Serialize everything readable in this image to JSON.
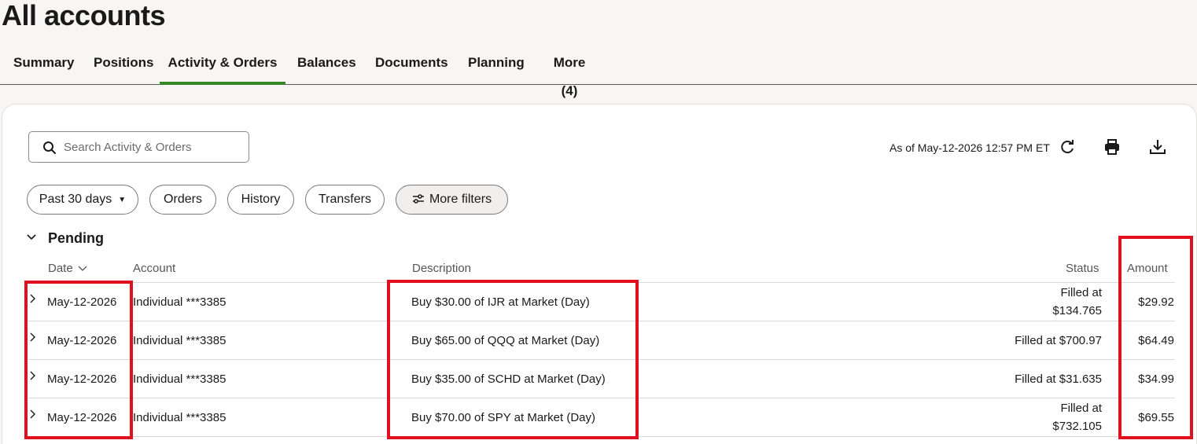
{
  "page": {
    "title": "All accounts"
  },
  "tabs": [
    {
      "label": "Summary"
    },
    {
      "label": "Positions"
    },
    {
      "label": "Activity & Orders",
      "active": true
    },
    {
      "label": "Balances"
    },
    {
      "label": "Documents"
    },
    {
      "label": "Planning"
    },
    {
      "label": "More (4)"
    }
  ],
  "search": {
    "placeholder": "Search Activity & Orders",
    "value": ""
  },
  "toolbar": {
    "as_of": "As of May-12-2026 12:57 PM ET",
    "icons": [
      "refresh-icon",
      "print-icon",
      "download-icon"
    ]
  },
  "filters": {
    "period": "Past 30 days",
    "orders": "Orders",
    "history": "History",
    "transfers": "Transfers",
    "more": "More filters"
  },
  "section": {
    "title": "Pending"
  },
  "table": {
    "columns": {
      "date": "Date",
      "account": "Account",
      "description": "Description",
      "status": "Status",
      "amount": "Amount"
    },
    "rows": [
      {
        "date": "May-12-2026",
        "account": "Individual ***3385",
        "description": "Buy $30.00 of IJR at Market (Day)",
        "status_line1": "Filled at",
        "status_line2": "$134.765",
        "amount": "$29.92"
      },
      {
        "date": "May-12-2026",
        "account": "Individual ***3385",
        "description": "Buy $65.00 of QQQ at Market (Day)",
        "status_line1": "Filled at $700.97",
        "status_line2": "",
        "amount": "$64.49"
      },
      {
        "date": "May-12-2026",
        "account": "Individual ***3385",
        "description": "Buy $35.00 of SCHD at Market (Day)",
        "status_line1": "Filled at $31.635",
        "status_line2": "",
        "amount": "$34.99"
      },
      {
        "date": "May-12-2026",
        "account": "Individual ***3385",
        "description": "Buy $70.00 of SPY at Market (Day)",
        "status_line1": "Filled at",
        "status_line2": "$732.105",
        "amount": "$69.55"
      }
    ]
  },
  "colors": {
    "accent": "#368727",
    "highlight": "#e0101f"
  }
}
